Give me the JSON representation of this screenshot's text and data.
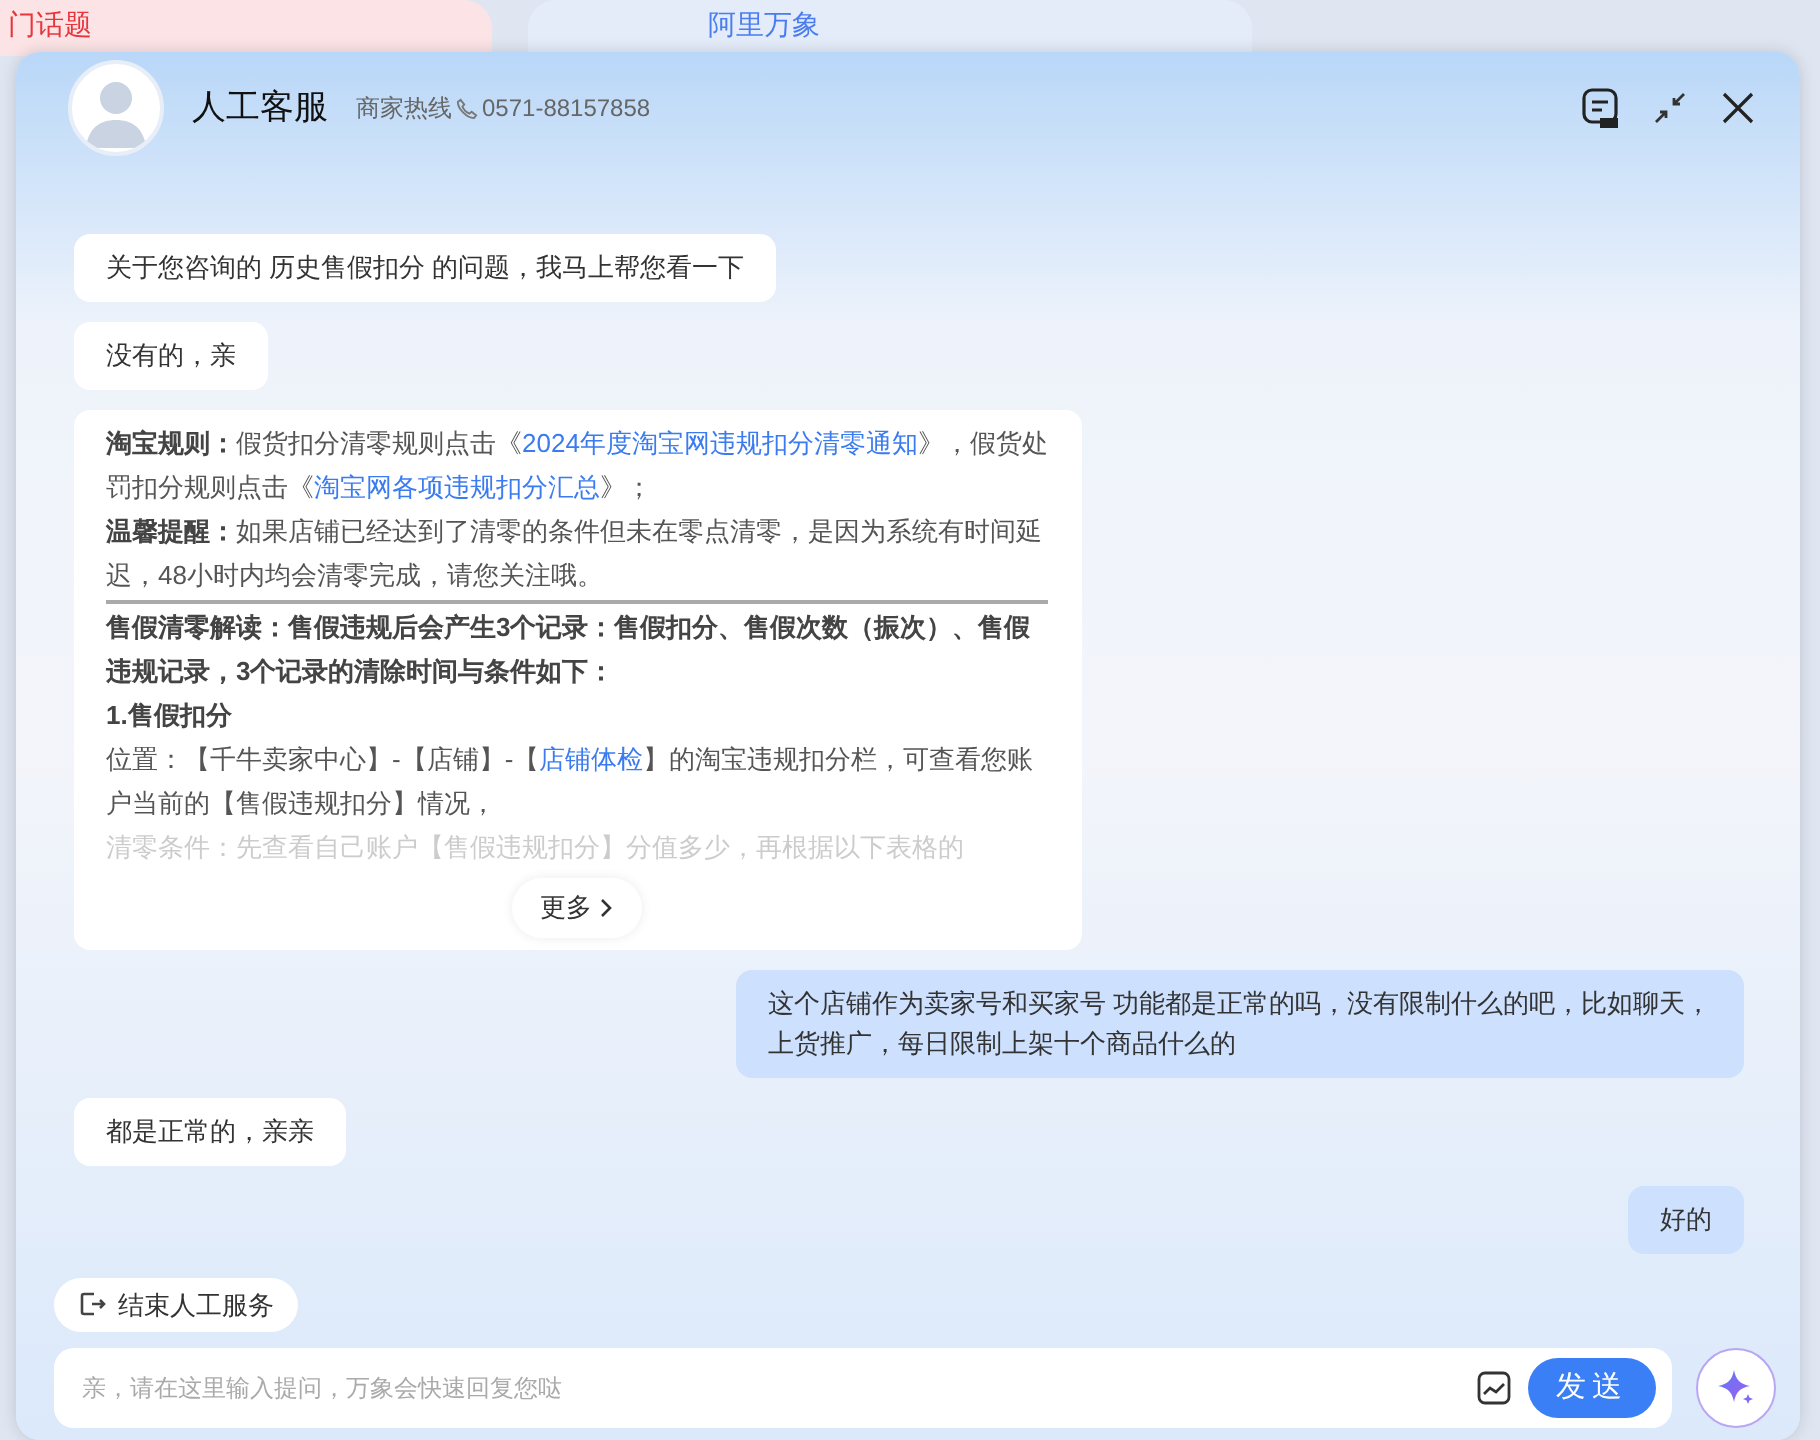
{
  "background": {
    "tabs": [
      {
        "label": "门话题"
      },
      {
        "label": "阿里万象"
      }
    ]
  },
  "header": {
    "title": "人工客服",
    "hotline_label": "商家热线",
    "phone": "0571-88157858"
  },
  "messages": [
    {
      "kind": "agent",
      "text": "关于您咨询的 历史售假扣分 的问题，我马上帮您看一下"
    },
    {
      "kind": "agent",
      "text": "没有的，亲"
    },
    {
      "kind": "rich",
      "more": "更多",
      "paragraphs": [
        {
          "kind": "text",
          "segments": [
            {
              "kind": "bold",
              "text": "淘宝规则："
            },
            {
              "kind": "plain",
              "text": "假货扣分清零规则点击《"
            },
            {
              "kind": "link",
              "text": "2024年度淘宝网违规扣分清零通知"
            },
            {
              "kind": "plain",
              "text": "》，假货处罚扣分规则点击《"
            },
            {
              "kind": "link",
              "text": "淘宝网各项违规扣分汇总"
            },
            {
              "kind": "plain",
              "text": "》；"
            }
          ]
        },
        {
          "kind": "text",
          "segments": [
            {
              "kind": "bold",
              "text": "温馨提醒："
            },
            {
              "kind": "plain",
              "text": "如果店铺已经达到了清零的条件但未在零点清零，是因为系统有时间延迟，48小时内均会清零完成，请您关注哦。"
            }
          ]
        },
        {
          "kind": "rule"
        },
        {
          "kind": "text",
          "segments": [
            {
              "kind": "bold",
              "text": "售假清零解读：售假违规后会产生3个记录：售假扣分、售假次数（振次）、售假违规记录，3个记录的清除时间与条件如下："
            }
          ]
        },
        {
          "kind": "text",
          "segments": [
            {
              "kind": "bold",
              "text": "1.售假扣分"
            }
          ]
        },
        {
          "kind": "text",
          "segments": [
            {
              "kind": "plain",
              "text": "位置：【千牛卖家中心】-【店铺】-【"
            },
            {
              "kind": "link",
              "text": "店铺体检"
            },
            {
              "kind": "plain",
              "text": "】的淘宝违规扣分栏，可查看您账户当前的【售假违规扣分】情况，"
            }
          ]
        },
        {
          "kind": "faded",
          "segments": [
            {
              "kind": "plain",
              "text": "清零条件：先查看自己账户【售假违规扣分】分值多少，再根据以下表格的"
            }
          ]
        }
      ]
    },
    {
      "kind": "user",
      "text": "这个店铺作为卖家号和买家号 功能都是正常的吗，没有限制什么的吧，比如聊天，上货推广，每日限制上架十个商品什么的"
    },
    {
      "kind": "agent",
      "text": "都是正常的，亲亲"
    },
    {
      "kind": "user",
      "text": "好的"
    }
  ],
  "end_service": {
    "label": "结束人工服务"
  },
  "input": {
    "placeholder": "亲，请在这里输入提问，万象会快速回复您哒",
    "send": "发送"
  }
}
